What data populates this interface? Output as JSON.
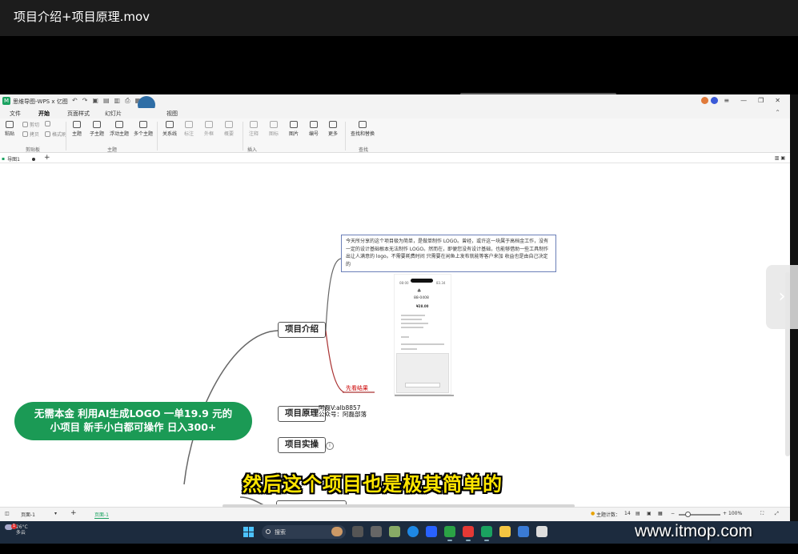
{
  "player": {
    "title": "项目介绍+项目原理.mov"
  },
  "wps": {
    "app_name": "思维导图-WPS x 亿图",
    "tabs": [
      "文件",
      "开始",
      "页面样式",
      "幻灯片",
      "视图"
    ],
    "active_tab": "开始",
    "ribbon": {
      "paste": "粘贴",
      "cut": "剪切",
      "copy": "拷贝",
      "format_painter": "格式刷",
      "group_clipboard": "剪贴板",
      "topic": "主题",
      "subtopic": "子主题",
      "floating_topic": "浮动主题",
      "multi_topic": "多个主题",
      "group_topic": "主题",
      "relation": "关系线",
      "callout": "标注",
      "boundary": "外框",
      "summary": "概要",
      "comment": "注释",
      "tag": "图标",
      "image": "图片",
      "numbering": "编号",
      "more": "更多",
      "group_insert": "插入",
      "find_replace": "查找和替换",
      "group_find": "查找"
    },
    "doc_tab": "导图1",
    "status": {
      "page_select": "页面-1",
      "page_tab": "页面-1",
      "topic_count_label": "主题计数：",
      "topic_count": "14",
      "zoom": "100%"
    }
  },
  "mindmap": {
    "root_line1": "无需本金  利用AI生成LOGO   一单19.9 元的",
    "root_line2": "小项目  新手小白都可操作  日入300+",
    "branches": [
      "项目介绍",
      "项目原理",
      "项目实操"
    ],
    "note": "今天所分享的这个项目极为简单，是做单制作 LOGO。曾经，或许这一块属于高档金工作，没有一定的设计基础根本无法制作 LOGO。然而在，即便您没有设计基础，也能够借助一些工具制作出让人满意的 logo。不需要耗费时间 只需要在闲鱼上发布就能等客户来加  收益也是由自己决定的",
    "phone": {
      "left": "08:00",
      "right": "83.34",
      "code": "88-0408",
      "price": "¥28.00"
    },
    "red_label": "先看结果",
    "watermark_line1": "阿磊V:alb8857",
    "watermark_line2": "公众号：阿磊部落"
  },
  "subtitle": "然后这个项目也是极其简单的",
  "taskbar": {
    "temperature": "26°C",
    "weather": "多云",
    "badge": "1",
    "search": "搜索"
  },
  "site_watermark": "www.itmop.com"
}
